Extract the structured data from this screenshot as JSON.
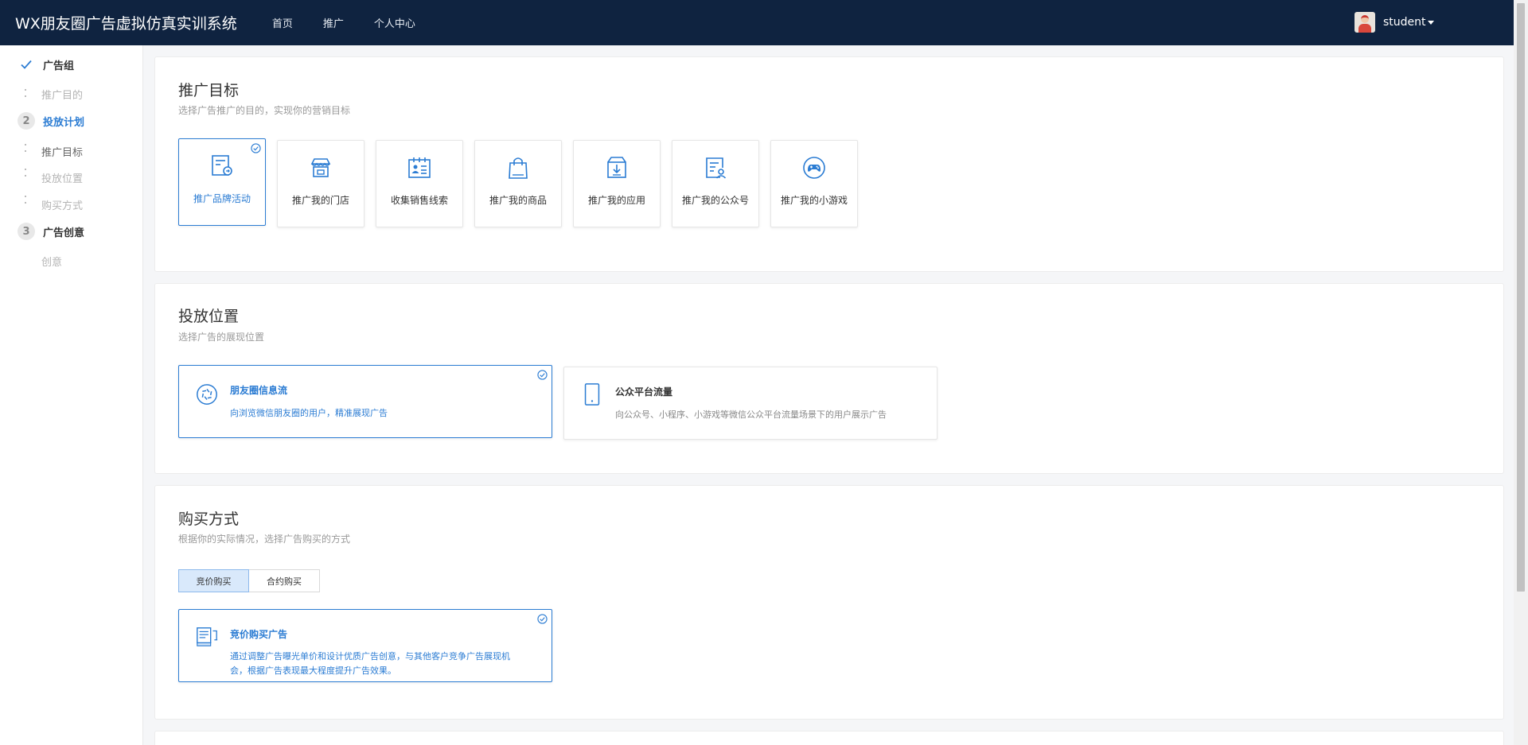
{
  "header": {
    "brand": "WX朋友圈广告虚拟仿真实训系统",
    "nav": [
      "首页",
      "推广",
      "个人中心"
    ],
    "username": "student"
  },
  "sidebar": {
    "steps": [
      {
        "label": "广告组",
        "state": "done",
        "subs": [
          "推广目的"
        ]
      },
      {
        "num": "2",
        "label": "投放计划",
        "state": "active",
        "subs": [
          "推广目标",
          "投放位置",
          "购买方式"
        ]
      },
      {
        "num": "3",
        "label": "广告创意",
        "state": "pending",
        "subs": [
          "创意"
        ]
      }
    ]
  },
  "goal_section": {
    "title": "推广目标",
    "desc": "选择广告推广的目的，实现你的营销目标",
    "options": [
      {
        "label": "推广品牌活动",
        "icon": "brand-activity-icon",
        "selected": true
      },
      {
        "label": "推广我的门店",
        "icon": "store-icon",
        "selected": false
      },
      {
        "label": "收集销售线索",
        "icon": "sales-leads-icon",
        "selected": false
      },
      {
        "label": "推广我的商品",
        "icon": "shopping-bag-icon",
        "selected": false
      },
      {
        "label": "推广我的应用",
        "icon": "app-download-icon",
        "selected": false
      },
      {
        "label": "推广我的公众号",
        "icon": "official-account-icon",
        "selected": false
      },
      {
        "label": "推广我的小游戏",
        "icon": "gamepad-icon",
        "selected": false
      }
    ]
  },
  "placement_section": {
    "title": "投放位置",
    "desc": "选择广告的展现位置",
    "options": [
      {
        "title": "朋友圈信息流",
        "desc": "向浏览微信朋友圈的用户，精准展现广告",
        "icon": "moments-icon",
        "selected": true
      },
      {
        "title": "公众平台流量",
        "desc": "向公众号、小程序、小游戏等微信公众平台流量场景下的用户展示广告",
        "icon": "tablet-icon",
        "selected": false
      }
    ]
  },
  "purchase_section": {
    "title": "购买方式",
    "desc": "根据你的实际情况，选择广告购买的方式",
    "tabs": [
      "竞价购买",
      "合约购买"
    ],
    "active_tab": 0,
    "option": {
      "title": "竞价购买广告",
      "desc": "通过调整广告曝光单价和设计优质广告创意，与其他客户竞争广告展现机会，根据广告表现最大程度提升广告效果。",
      "icon": "bidding-icon"
    }
  },
  "colors": {
    "header_bg": "#0f2340",
    "accent": "#2b7cd3"
  }
}
